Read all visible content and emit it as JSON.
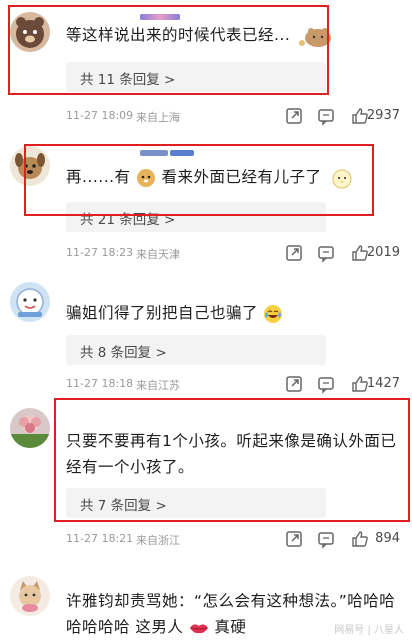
{
  "comments": [
    {
      "text_a": "等这样说出来的时候代表已经...",
      "reply_label": "共 11 条回复 >",
      "time": "11-27 18:09",
      "source": "来自上海",
      "likes": "2937",
      "avatar": "bear-avatar"
    },
    {
      "text_a": "再......有",
      "text_b": "看来外面已经有儿子了",
      "reply_label": "共 21 条回复 >",
      "time": "11-27 18:23",
      "source": "来自天津",
      "likes": "2019",
      "avatar": "dog-avatar"
    },
    {
      "text_a": "骗姐们得了别把自己也骗了",
      "reply_label": "共 8 条回复 >",
      "time": "11-27 18:18",
      "source": "来自江苏",
      "likes": "1427",
      "avatar": "cartoon-avatar"
    },
    {
      "text_a": "只要不要再有1个小孩。听起来像是确认外面已",
      "text_b": "经有一个小孩了。",
      "reply_label": "共 7 条回复 >",
      "time": "11-27 18:21",
      "source": "来自浙江",
      "likes": "894",
      "avatar": "flower-avatar"
    },
    {
      "text_a": "许雅钧却责骂她：“怎么会有这种想法。”哈哈哈",
      "text_b": "哈哈哈哈 这男人",
      "text_c": "真硬",
      "avatar": "cat-avatar"
    }
  ],
  "watermark": "网易号 | 八星人",
  "colors": {
    "highlight": "#e02020",
    "reply_bg": "#f3f3f3",
    "meta": "#9a9a9a"
  }
}
